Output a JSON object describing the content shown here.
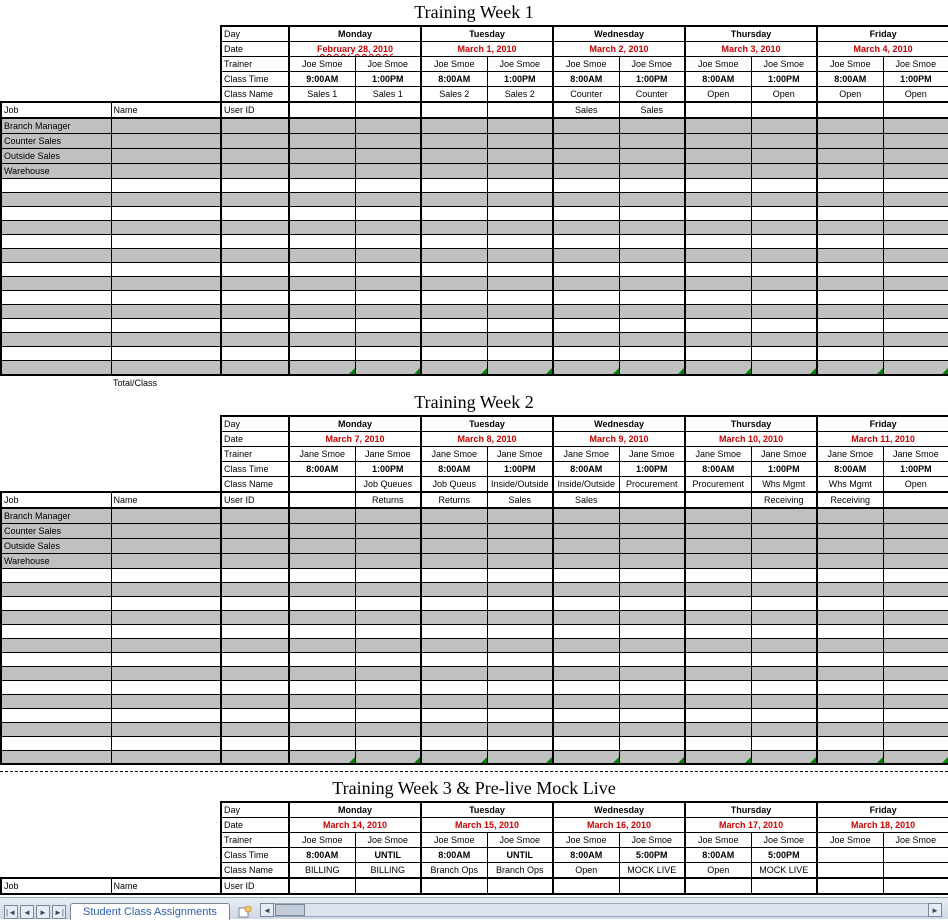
{
  "labels": {
    "day": "Day",
    "date": "Date",
    "trainer": "Trainer",
    "classTime": "Class Time",
    "className": "Class Name",
    "userId": "User ID",
    "job": "Job",
    "name": "Name",
    "totalClass": "Total/Class"
  },
  "jobs": [
    "Branch Manager",
    "Counter Sales",
    "Outside Sales",
    "Warehouse"
  ],
  "weeks": [
    {
      "title": "Training Week 1",
      "showTotal": true,
      "days": [
        {
          "day": "Monday",
          "date": "February 28, 2010",
          "underlineDate": true,
          "slots": [
            {
              "trainer": "Joe Smoe",
              "time": "9:00AM",
              "className": "Sales 1"
            },
            {
              "trainer": "Joe Smoe",
              "time": "1:00PM",
              "className": "Sales 1"
            }
          ]
        },
        {
          "day": "Tuesday",
          "date": "March 1, 2010",
          "slots": [
            {
              "trainer": "Joe Smoe",
              "time": "8:00AM",
              "className": "Sales 2"
            },
            {
              "trainer": "Joe Smoe",
              "time": "1:00PM",
              "className": "Sales 2"
            }
          ]
        },
        {
          "day": "Wednesday",
          "date": "March 2, 2010",
          "slots": [
            {
              "trainer": "Joe Smoe",
              "time": "8:00AM",
              "className": "Counter Sales"
            },
            {
              "trainer": "Joe Smoe",
              "time": "1:00PM",
              "className": "Counter Sales"
            }
          ]
        },
        {
          "day": "Thursday",
          "date": "March 3, 2010",
          "slots": [
            {
              "trainer": "Joe Smoe",
              "time": "8:00AM",
              "className": "Open"
            },
            {
              "trainer": "Joe Smoe",
              "time": "1:00PM",
              "className": "Open"
            }
          ]
        },
        {
          "day": "Friday",
          "date": "March 4, 2010",
          "slots": [
            {
              "trainer": "Joe Smoe",
              "time": "8:00AM",
              "className": "Open"
            },
            {
              "trainer": "Joe Smoe",
              "time": "1:00PM",
              "className": "Open"
            }
          ]
        }
      ],
      "blankRows": 14
    },
    {
      "title": "Training Week 2",
      "showTotal": false,
      "days": [
        {
          "day": "Monday",
          "date": "March 7, 2010",
          "slots": [
            {
              "trainer": "Jane Smoe",
              "time": "8:00AM",
              "className": ""
            },
            {
              "trainer": "Jane Smoe",
              "time": "1:00PM",
              "className": "Job Queues Returns"
            }
          ]
        },
        {
          "day": "Tuesday",
          "date": "March 8, 2010",
          "slots": [
            {
              "trainer": "Jane Smoe",
              "time": "8:00AM",
              "className": "Job Queus Returns"
            },
            {
              "trainer": "Jane Smoe",
              "time": "1:00PM",
              "className": "Inside/Outside Sales"
            }
          ]
        },
        {
          "day": "Wednesday",
          "date": "March 9, 2010",
          "slots": [
            {
              "trainer": "Jane Smoe",
              "time": "8:00AM",
              "className": "Inside/Outside Sales"
            },
            {
              "trainer": "Jane Smoe",
              "time": "1:00PM",
              "className": "Procurement"
            }
          ]
        },
        {
          "day": "Thursday",
          "date": "March 10, 2010",
          "slots": [
            {
              "trainer": "Jane Smoe",
              "time": "8:00AM",
              "className": "Procurement"
            },
            {
              "trainer": "Jane Smoe",
              "time": "1:00PM",
              "className": "Whs Mgmt Receiving"
            }
          ]
        },
        {
          "day": "Friday",
          "date": "March 11, 2010",
          "slots": [
            {
              "trainer": "Jane Smoe",
              "time": "8:00AM",
              "className": "Whs Mgmt Receiving"
            },
            {
              "trainer": "Jane Smoe",
              "time": "1:00PM",
              "className": "Open"
            }
          ]
        }
      ],
      "blankRows": 14
    },
    {
      "title": "Training Week 3 & Pre-live Mock Live",
      "showTotal": false,
      "days": [
        {
          "day": "Monday",
          "date": "March 14, 2010",
          "slots": [
            {
              "trainer": "Joe Smoe",
              "time": "8:00AM",
              "className": "BILLING"
            },
            {
              "trainer": "Joe Smoe",
              "time": "UNTIL",
              "className": "BILLING"
            }
          ]
        },
        {
          "day": "Tuesday",
          "date": "March 15, 2010",
          "slots": [
            {
              "trainer": "Joe Smoe",
              "time": "8:00AM",
              "className": "Branch Ops"
            },
            {
              "trainer": "Joe Smoe",
              "time": "UNTIL",
              "className": "Branch Ops"
            }
          ]
        },
        {
          "day": "Wednesday",
          "date": "March 16, 2010",
          "slots": [
            {
              "trainer": "Joe Smoe",
              "time": "8:00AM",
              "className": "Open"
            },
            {
              "trainer": "Joe Smoe",
              "time": "5:00PM",
              "className": "MOCK LIVE"
            }
          ]
        },
        {
          "day": "Thursday",
          "date": "March 17, 2010",
          "slots": [
            {
              "trainer": "Joe Smoe",
              "time": "8:00AM",
              "className": "Open"
            },
            {
              "trainer": "Joe Smoe",
              "time": "5:00PM",
              "className": "MOCK LIVE"
            }
          ]
        },
        {
          "day": "Friday",
          "date": "March 18, 2010",
          "slots": [
            {
              "trainer": "Joe Smoe",
              "time": "",
              "className": ""
            },
            {
              "trainer": "Joe Smoe",
              "time": "",
              "className": ""
            }
          ]
        }
      ],
      "blankRows": 0,
      "truncated": true
    }
  ],
  "tab": {
    "name": "Student Class Assignments"
  }
}
